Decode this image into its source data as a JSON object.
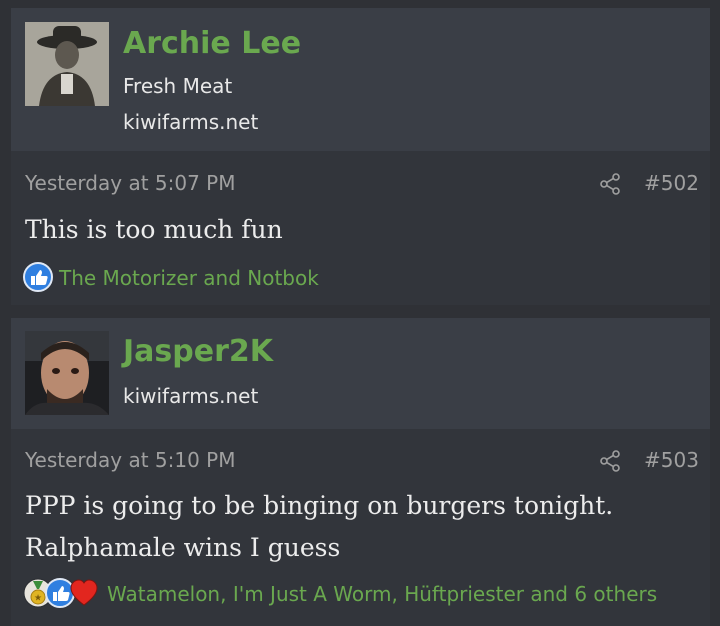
{
  "posts": [
    {
      "username": "Archie Lee",
      "user_title": "Fresh Meat",
      "site": "kiwifarms.net",
      "date": "Yesterday at 5:07 PM",
      "post_number": "#502",
      "message_lines": [
        "This is too much fun"
      ],
      "reactions": {
        "icons": [
          "like-icon"
        ],
        "names": "The Motorizer and Notbok"
      }
    },
    {
      "username": "Jasper2K",
      "site": "kiwifarms.net",
      "date": "Yesterday at 5:10 PM",
      "post_number": "#503",
      "message_lines": [
        "PPP is going to be binging on burgers tonight.",
        "Ralphamale wins I guess"
      ],
      "reactions": {
        "icons": [
          "medal-icon",
          "like-icon",
          "heart-icon"
        ],
        "names": "Watamelon, I'm Just A Worm, Hüftpriester and 6 others"
      }
    }
  ],
  "colors": {
    "background": "#2f3136",
    "header": "#3a3e46",
    "body": "#32353b",
    "username": "#6aa84f",
    "muted": "#a0a0a0"
  }
}
